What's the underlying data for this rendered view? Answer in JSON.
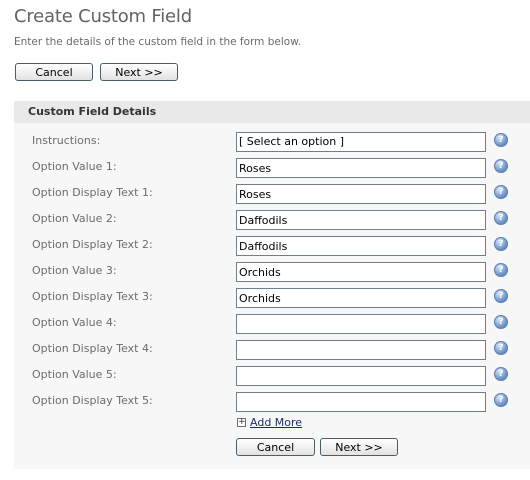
{
  "page": {
    "title": "Create Custom Field",
    "subtitle": "Enter the details of the custom field in the form below."
  },
  "top_buttons": {
    "cancel": "Cancel",
    "next": "Next >>"
  },
  "panel": {
    "header": "Custom Field Details",
    "rows": [
      {
        "label": "Instructions:",
        "value": "[ Select an option ]"
      },
      {
        "label": "Option Value 1:",
        "value": "Roses"
      },
      {
        "label": "Option Display Text 1:",
        "value": "Roses"
      },
      {
        "label": "Option Value 2:",
        "value": "Daffodils"
      },
      {
        "label": "Option Display Text 2:",
        "value": "Daffodils"
      },
      {
        "label": "Option Value 3:",
        "value": "Orchids"
      },
      {
        "label": "Option Display Text 3:",
        "value": "Orchids"
      },
      {
        "label": "Option Value 4:",
        "value": ""
      },
      {
        "label": "Option Display Text 4:",
        "value": ""
      },
      {
        "label": "Option Value 5:",
        "value": ""
      },
      {
        "label": "Option Display Text 5:",
        "value": ""
      }
    ],
    "help_icon_glyph": "?",
    "add_more_icon_glyph": "+",
    "add_more_label": "Add More"
  },
  "bottom_buttons": {
    "cancel": "Cancel",
    "next": "Next >>"
  },
  "icons": {
    "help": "help-question-icon",
    "add": "plus-box-icon"
  },
  "colors": {
    "title": "#636363",
    "panel_bg": "#f7f7f7",
    "panel_header_bg": "#e9e9e9",
    "link": "#1d2f6b",
    "help_icon": "#7a9fd0"
  }
}
